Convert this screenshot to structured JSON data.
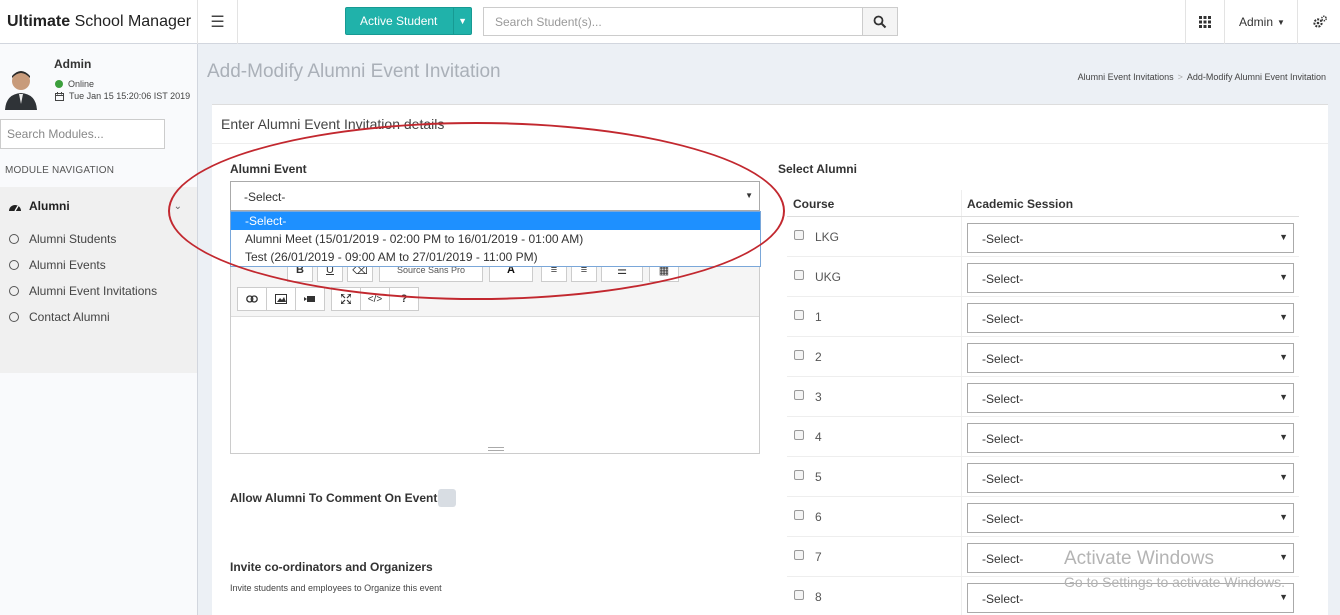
{
  "header": {
    "brand_bold": "Ultimate",
    "brand_rest": " School Manager",
    "active_student_label": "Active Student",
    "search_placeholder": "Search Student(s)...",
    "admin_label": "Admin"
  },
  "sidebar": {
    "user_name": "Admin",
    "status": "Online",
    "datetime": "Tue Jan 15 15:20:06 IST 2019",
    "search_placeholder": "Search Modules...",
    "nav_heading": "MODULE NAVIGATION",
    "parent": "Alumni",
    "items": [
      "Alumni Students",
      "Alumni Events",
      "Alumni Event Invitations",
      "Contact Alumni"
    ]
  },
  "page": {
    "title": "Add-Modify Alumni Event Invitation",
    "breadcrumb": [
      "Alumni Event Invitations",
      "Add-Modify Alumni Event Invitation"
    ],
    "panel_heading": "Enter Alumni Event Invitation details"
  },
  "form": {
    "event_label": "Alumni Event",
    "event_selected": "-Select-",
    "event_options": [
      "-Select-",
      "Alumni Meet (15/01/2019 - 02:00 PM to 16/01/2019 - 01:00 AM)",
      "Test (26/01/2019 - 09:00 AM to 27/01/2019 - 11:00 PM)"
    ],
    "toolbar_font": "Source Sans Pro",
    "allow_comment_label": "Allow Alumni To Comment On Event",
    "invite_label": "Invite co-ordinators and Organizers",
    "invite_sub": "Invite students and employees to Organize this event"
  },
  "alumni": {
    "heading": "Select Alumni",
    "col_course": "Course",
    "col_session": "Academic Session",
    "session_placeholder": "-Select-",
    "courses": [
      "LKG",
      "UKG",
      "1",
      "2",
      "3",
      "4",
      "5",
      "6",
      "7",
      "8"
    ]
  },
  "watermark": {
    "line1": "Activate Windows",
    "line2": "Go to Settings to activate Windows."
  },
  "colors": {
    "accent": "#20b2aa",
    "annotation": "#c2282f",
    "selection": "#1e90ff"
  }
}
